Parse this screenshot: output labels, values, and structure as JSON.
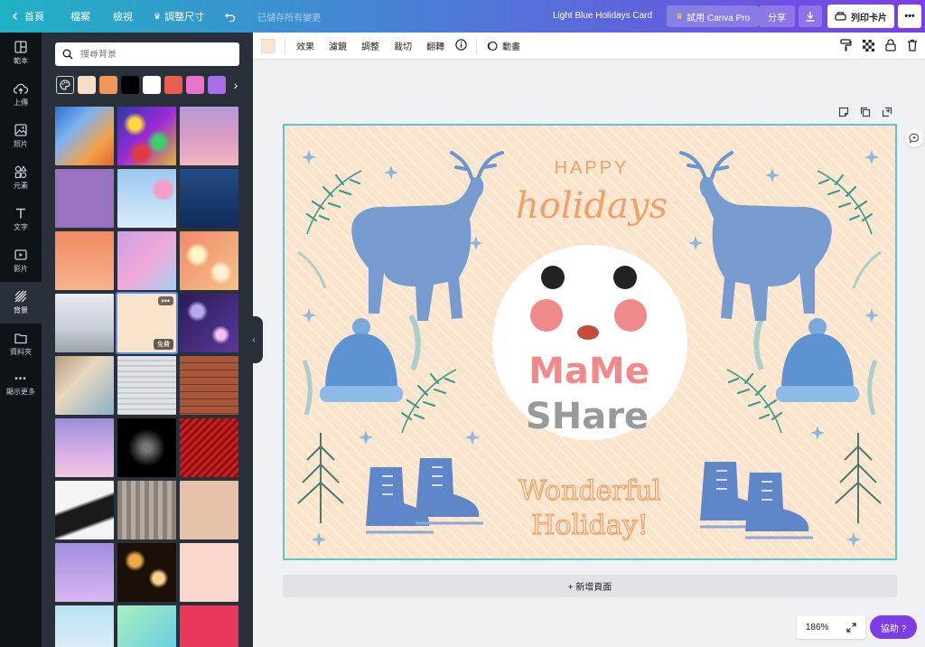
{
  "topbar": {
    "home": "首頁",
    "file": "檔案",
    "view": "檢視",
    "resize": "調整尺寸",
    "saved": "已儲存所有變更",
    "doc_title": "Light Blue Holidays Card",
    "try_pro": "試用 Canva Pro",
    "share": "分享",
    "print": "列印卡片"
  },
  "rail": [
    {
      "label": "範本",
      "icon": "template-icon"
    },
    {
      "label": "上傳",
      "icon": "upload-icon"
    },
    {
      "label": "照片",
      "icon": "photo-icon"
    },
    {
      "label": "元素",
      "icon": "elements-icon"
    },
    {
      "label": "文字",
      "icon": "text-icon"
    },
    {
      "label": "影片",
      "icon": "video-icon"
    },
    {
      "label": "背景",
      "icon": "background-icon"
    },
    {
      "label": "資料夾",
      "icon": "folder-icon"
    },
    {
      "label": "顯示更多",
      "icon": "more-icon"
    }
  ],
  "panel": {
    "search_placeholder": "搜尋背景",
    "swatches": [
      "#f7dcc7",
      "#f0975e",
      "#000000",
      "#ffffff",
      "#ea5e4e",
      "#e774c8",
      "#a86ee6"
    ],
    "free_badge": "免費",
    "more_badge": "•••"
  },
  "toolbar": {
    "color": "#fae4cc",
    "effects": "效果",
    "filter": "濾鏡",
    "adjust": "調整",
    "crop": "裁切",
    "flip": "翻轉",
    "animate": "動畫"
  },
  "design": {
    "happy": "HAPPY",
    "holidays": "holidays",
    "logo_top": "MaMe",
    "logo_bottom": "SHare",
    "wonderful": "Wonderful",
    "holiday": "Holiday!",
    "colors": {
      "bg": "#fae4cc",
      "blue": "#6b95cf",
      "orange": "#f0a06a",
      "green": "#3e9b8a"
    }
  },
  "canvas": {
    "add_page": "+ 新增頁面",
    "zoom": "186%",
    "help": "協助 ?"
  }
}
